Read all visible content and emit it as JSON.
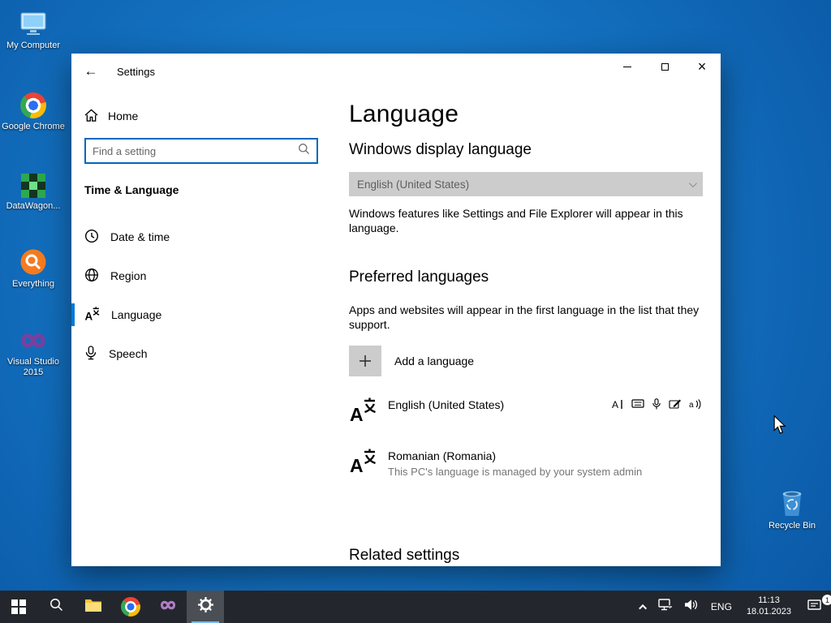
{
  "desktop": {
    "icons": [
      {
        "label": "My Computer"
      },
      {
        "label": "Google Chrome"
      },
      {
        "label": "DataWagon..."
      },
      {
        "label": "Everything"
      },
      {
        "label": "Visual Studio 2015"
      },
      {
        "label": "Recycle Bin"
      }
    ]
  },
  "window": {
    "title": "Settings",
    "back_glyph": "←",
    "controls": {
      "close": "×"
    },
    "sidebar": {
      "home_label": "Home",
      "search_placeholder": "Find a setting",
      "section_title": "Time & Language",
      "items": [
        {
          "label": "Date & time"
        },
        {
          "label": "Region"
        },
        {
          "label": "Language"
        },
        {
          "label": "Speech"
        }
      ],
      "selected_item": "Language"
    },
    "main": {
      "page_title": "Language",
      "display_language_heading": "Windows display language",
      "display_language_value": "English (United States)",
      "display_language_desc": "Windows features like Settings and File Explorer will appear in this language.",
      "preferred_heading": "Preferred languages",
      "preferred_desc": "Apps and websites will appear in the first language in the list that they support.",
      "add_language_label": "Add a language",
      "languages": [
        {
          "name": "English (United States)",
          "note": ""
        },
        {
          "name": "Romanian (Romania)",
          "note": "This PC's language is managed by your system admin"
        }
      ],
      "related_heading": "Related settings"
    }
  },
  "taskbar": {
    "tray": {
      "language": "ENG",
      "time": "11:13",
      "date": "18.01.2023",
      "badge": "1"
    }
  },
  "colors": {
    "accent": "#0078d7",
    "search_border": "#0067c0",
    "disabled_bg": "#cccccc"
  }
}
